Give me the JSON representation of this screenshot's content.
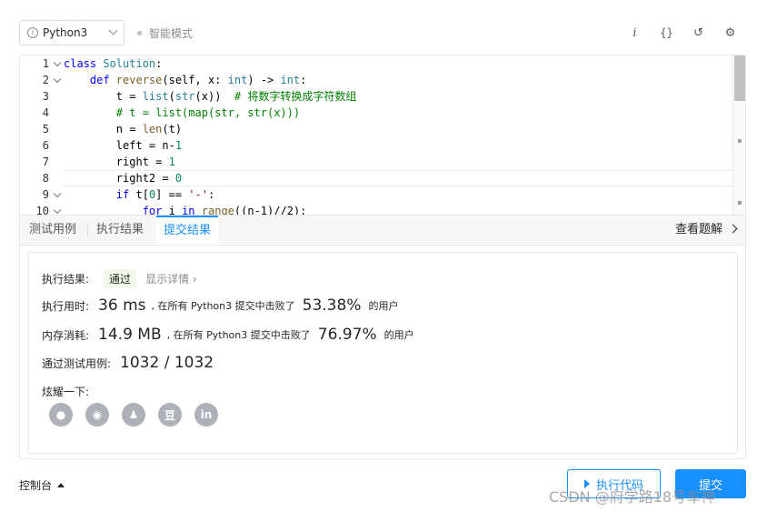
{
  "toolbar": {
    "language": "Python3",
    "mode": "智能模式",
    "tools": [
      "i",
      "{}",
      "↺",
      "⚙"
    ]
  },
  "editor": {
    "lines": [
      {
        "n": "1",
        "fold": true
      },
      {
        "n": "2",
        "fold": true
      },
      {
        "n": "3",
        "fold": false
      },
      {
        "n": "4",
        "fold": false
      },
      {
        "n": "5",
        "fold": false
      },
      {
        "n": "6",
        "fold": false
      },
      {
        "n": "7",
        "fold": false
      },
      {
        "n": "8",
        "fold": false
      },
      {
        "n": "9",
        "fold": true
      },
      {
        "n": "10",
        "fold": true
      }
    ],
    "code": {
      "l1a": "class ",
      "l1b": "Solution",
      "l1c": ":",
      "l2a": "    def ",
      "l2b": "reverse",
      "l2c": "(self, x: ",
      "l2d": "int",
      "l2e": ") -> ",
      "l2f": "int",
      "l2g": ":",
      "l3a": "        t = ",
      "l3b": "list",
      "l3c": "(",
      "l3d": "str",
      "l3e": "(x))  ",
      "l3f": "# 将数字转换成字符数组",
      "l4": "        # t = list(map(str, str(x)))",
      "l5a": "        n = ",
      "l5b": "len",
      "l5c": "(t)",
      "l6a": "        left = n-",
      "l6b": "1",
      "l7a": "        right = ",
      "l7b": "1",
      "l8a": "        right2 = ",
      "l8b": "0",
      "l9a": "        ",
      "l9b": "if",
      "l9c": " t[",
      "l9d": "0",
      "l9e": "] == ",
      "l9f": "'-'",
      "l9g": ":",
      "l10a": "            ",
      "l10b": "for",
      "l10c": " i ",
      "l10d": "in",
      "l10e": " ",
      "l10f": "range",
      "l10g": "((n-1)//2):"
    }
  },
  "tabs": {
    "test": "测试用例",
    "run_result": "执行结果",
    "submit_result": "提交结果",
    "solution": "查看题解"
  },
  "result": {
    "status_label": "执行结果:",
    "status": "通过",
    "detail": "显示详情 ›",
    "time_label": "执行用时:",
    "time_value": "36 ms",
    "time_mid": ", 在所有 Python3 提交中击败了",
    "time_pct": "53.38%",
    "time_tail": "的用户",
    "mem_label": "内存消耗:",
    "mem_value": "14.9 MB",
    "mem_mid": ", 在所有 Python3 提交中击败了",
    "mem_pct": "76.97%",
    "mem_tail": "的用户",
    "cases_label": "通过测试用例:",
    "cases_value": "1032 / 1032",
    "share_label": "炫耀一下:",
    "shares": [
      {
        "icon": "wechat-icon",
        "glyph": "●"
      },
      {
        "icon": "weibo-icon",
        "glyph": "◉"
      },
      {
        "icon": "qq-icon",
        "glyph": "♟"
      },
      {
        "icon": "douban-icon",
        "glyph": "豆"
      },
      {
        "icon": "linkedin-icon",
        "glyph": "in"
      }
    ]
  },
  "footer": {
    "console": "控制台",
    "run": "执行代码",
    "submit": "提交",
    "watermark": "CSDN @府学路18号车神"
  }
}
